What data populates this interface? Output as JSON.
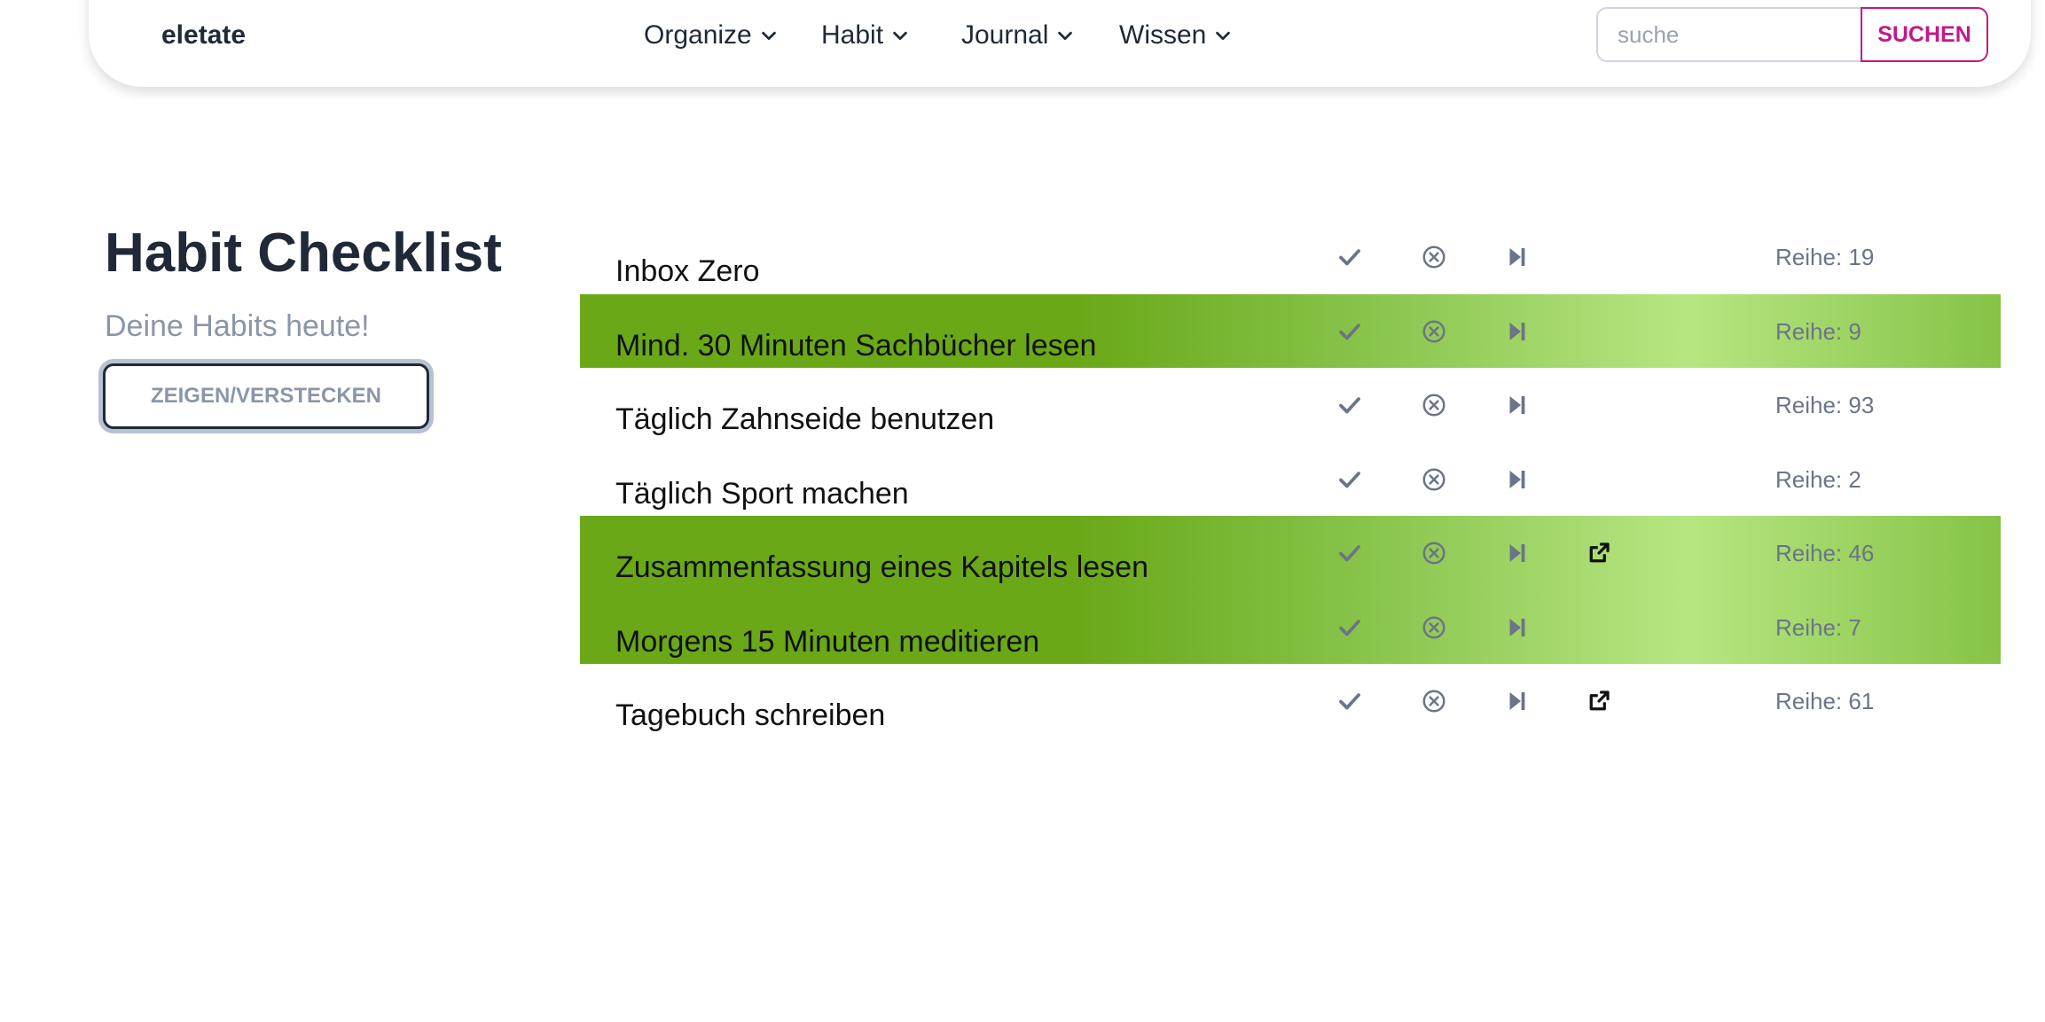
{
  "brand": "eletate",
  "nav": {
    "items": [
      {
        "label": "Organize",
        "icon": "chevron-down-icon"
      },
      {
        "label": "Habit",
        "icon": "chevron-down-icon"
      },
      {
        "label": "Journal",
        "icon": "chevron-down-icon"
      },
      {
        "label": "Wissen",
        "icon": "chevron-down-icon"
      }
    ],
    "search": {
      "placeholder": "suche",
      "value": "",
      "button_label": "SUCHEN"
    }
  },
  "colors": {
    "accent": "#c2188b",
    "text_dark": "#1f2937",
    "muted": "#8a96a8",
    "done_green": "#6aa818",
    "done_green_light": "#b6e682"
  },
  "sidebar": {
    "title": "Habit Checklist",
    "subtitle": "Deine Habits heute!",
    "toggle_label": "ZEIGEN/VERSTECKEN"
  },
  "habits": [
    {
      "name": "Inbox Zero",
      "streak_label": "Reihe:",
      "streak": "19",
      "done": false,
      "has_link": false
    },
    {
      "name": "Mind. 30 Minuten Sachbücher lesen",
      "streak_label": "Reihe:",
      "streak": "9",
      "done": true,
      "has_link": false
    },
    {
      "name": "Täglich Zahnseide benutzen",
      "streak_label": "Reihe:",
      "streak": "93",
      "done": false,
      "has_link": false
    },
    {
      "name": "Täglich Sport machen",
      "streak_label": "Reihe:",
      "streak": "2",
      "done": false,
      "has_link": false
    },
    {
      "name": "Zusammenfassung eines Kapitels lesen",
      "streak_label": "Reihe:",
      "streak": "46",
      "done": true,
      "has_link": true
    },
    {
      "name": "Morgens 15 Minuten meditieren",
      "streak_label": "Reihe:",
      "streak": "7",
      "done": true,
      "has_link": false
    },
    {
      "name": "Tagebuch schreiben",
      "streak_label": "Reihe:",
      "streak": "61",
      "done": false,
      "has_link": true
    }
  ],
  "icons": {
    "check": "check-icon",
    "dismiss": "x-circle-icon",
    "skip": "skip-forward-icon",
    "link": "external-link-icon"
  }
}
